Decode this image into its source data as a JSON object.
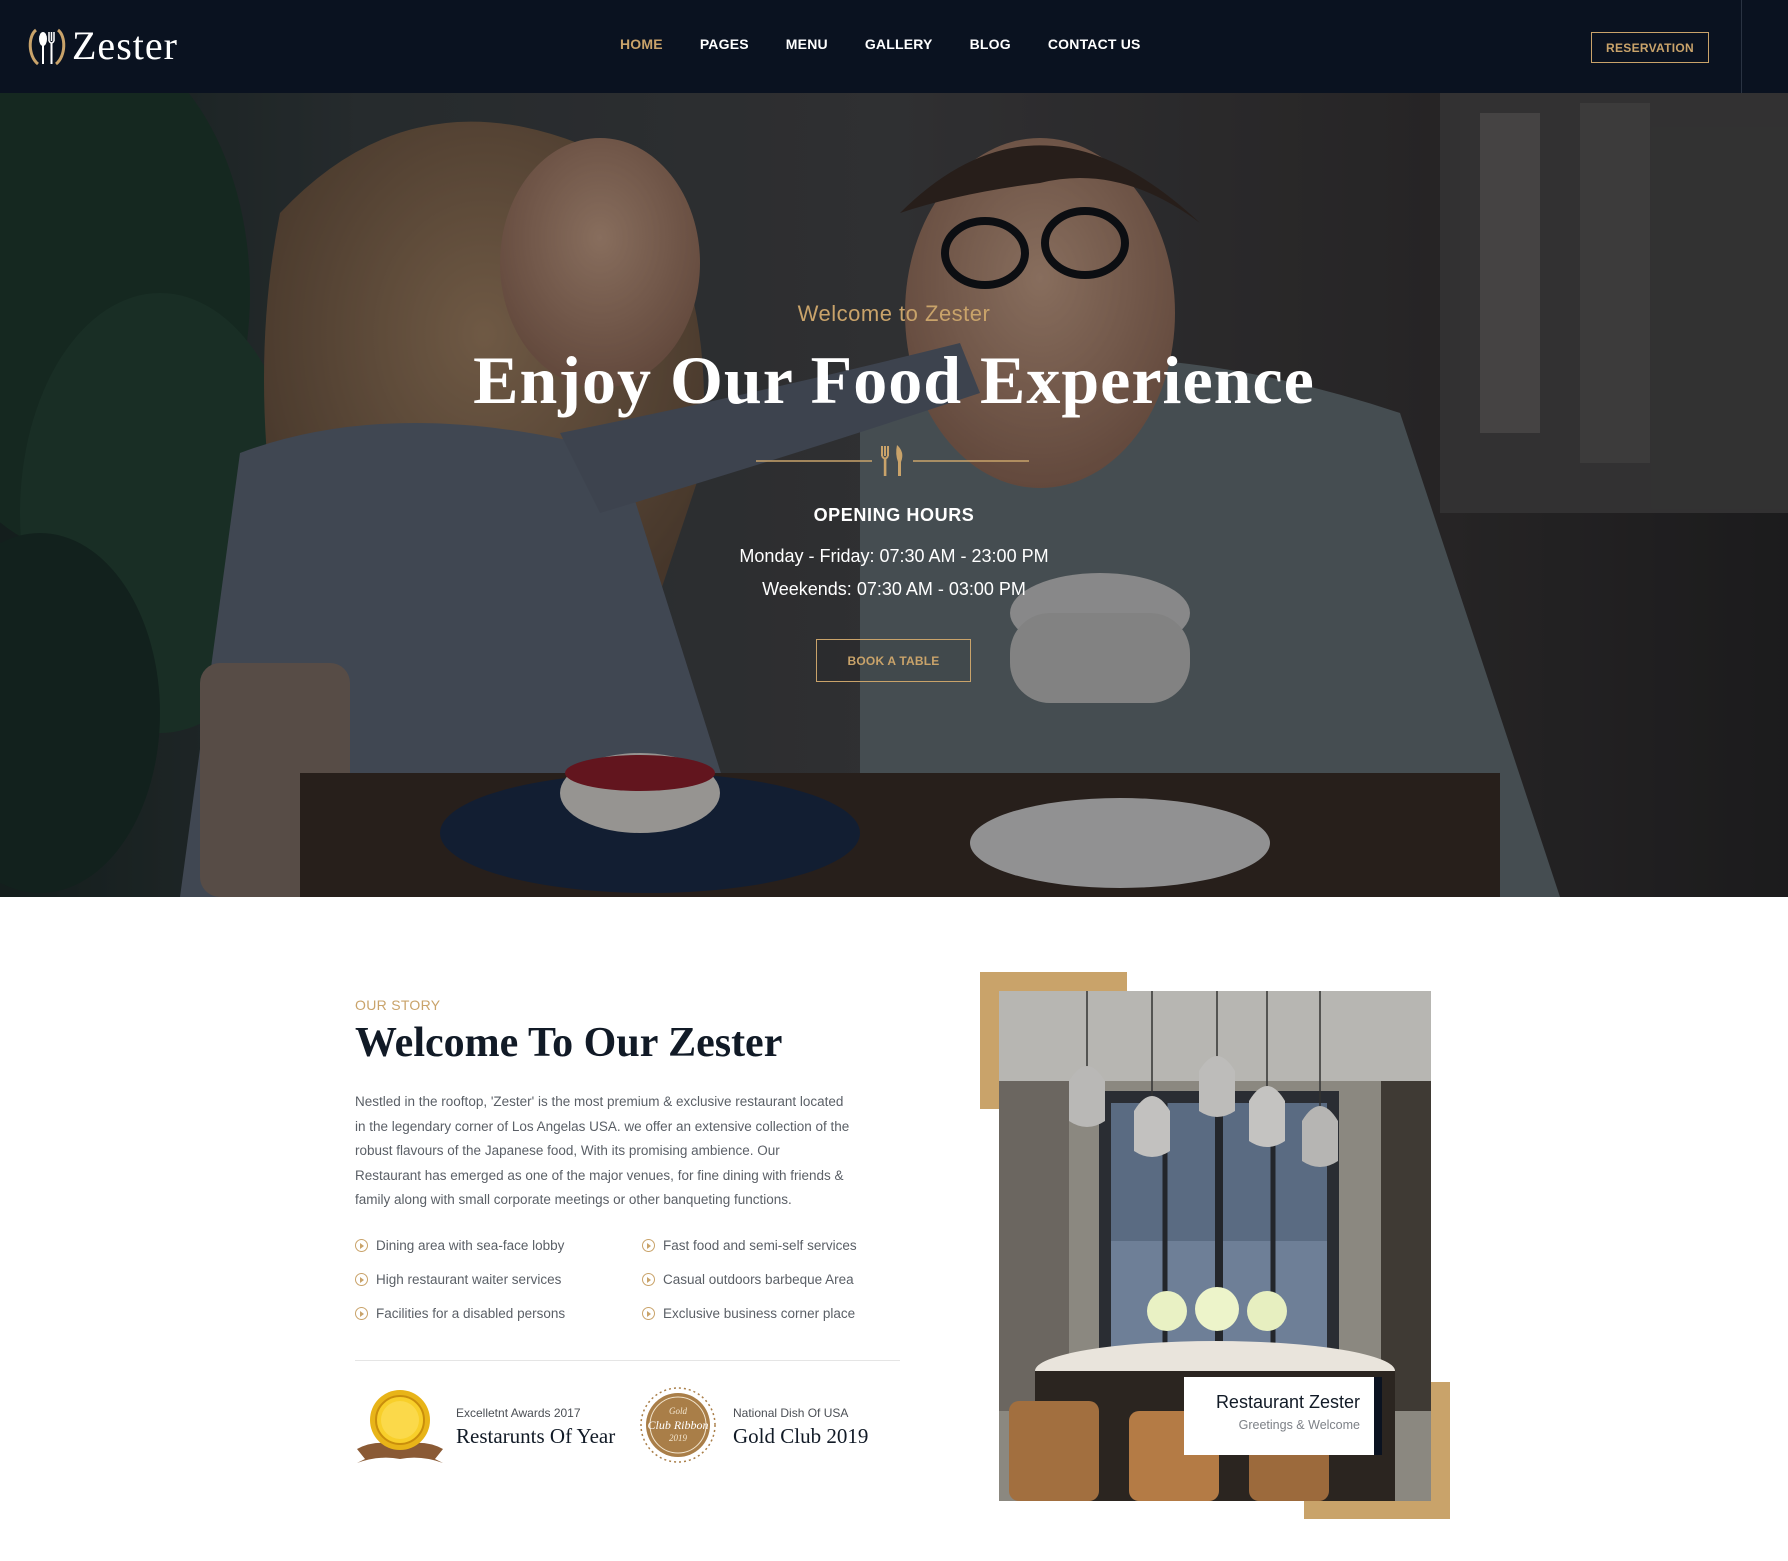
{
  "brand": {
    "name": "Zester",
    "accent_color": "#c9a36a",
    "dark_color": "#0a1220"
  },
  "nav": {
    "items": [
      {
        "label": "HOME",
        "active": true
      },
      {
        "label": "PAGES",
        "active": false
      },
      {
        "label": "MENU",
        "active": false
      },
      {
        "label": "GALLERY",
        "active": false
      },
      {
        "label": "BLOG",
        "active": false
      },
      {
        "label": "CONTACT US",
        "active": false
      }
    ],
    "reservation_label": "RESERVATION"
  },
  "hero": {
    "kicker": "Welcome to Zester",
    "title": "Enjoy Our Food Experience",
    "divider_icon": "fork-knife-icon",
    "hours_title": "OPENING HOURS",
    "hours": [
      {
        "day": "Monday - Friday:",
        "time": "07:30 AM - 23:00 PM"
      },
      {
        "day": "Weekends:",
        "time": "07:30 AM - 03:00 PM"
      }
    ],
    "book_label": "BOOK A TABLE"
  },
  "story": {
    "kicker": "OUR STORY",
    "title": "Welcome To Our Zester",
    "paragraph_lines": [
      "Nestled in the rooftop, 'Zester' is the most premium & exclusive restaurant located",
      "in the legendary corner of Los Angelas USA. we offer an extensive collection of the",
      "robust flavours of the Japanese food, With its promising ambience. Our",
      "Restaurant has emerged as one of the major venues, for fine dining with friends &",
      "family along with small corporate meetings or other banqueting functions."
    ],
    "features": [
      "Dining area with sea-face lobby",
      "Fast food and semi-self services",
      "High restaurant waiter services",
      "Casual outdoors barbeque Area",
      "Facilities for a disabled persons",
      "Exclusive business corner place"
    ],
    "awards": [
      {
        "small": "Excelletnt Awards 2017",
        "big": "Restarunts Of Year",
        "icon": "gold-medal-icon"
      },
      {
        "small": "National Dish Of USA",
        "big": "Gold Club 2019",
        "icon": "club-ribbon-badge-icon",
        "badge_lines": [
          "Gold",
          "Club Ribbon",
          "2019"
        ]
      }
    ]
  },
  "photo_card": {
    "title": "Restaurant Zester",
    "subtitle": "Greetings & Welcome"
  }
}
